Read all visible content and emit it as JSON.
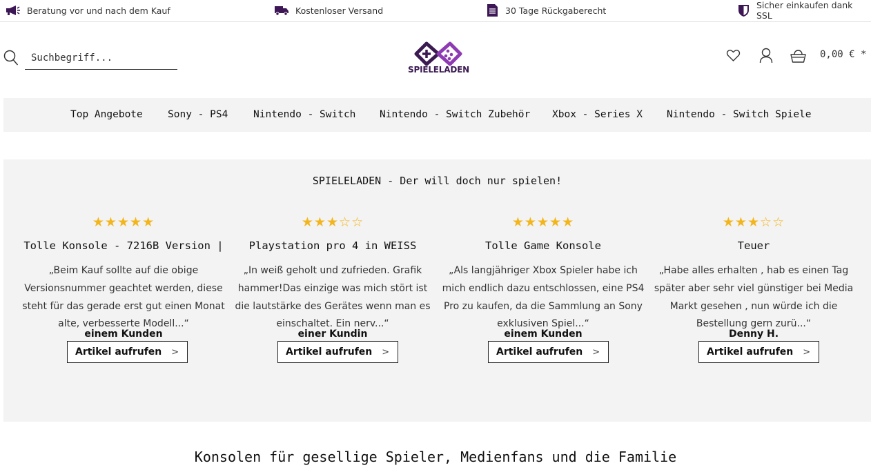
{
  "usp_bar": {
    "items": [
      {
        "icon": "megaphone-icon",
        "label": "Beratung vor und nach dem Kauf"
      },
      {
        "icon": "truck-icon",
        "label": "Kostenloser Versand"
      },
      {
        "icon": "document-icon",
        "label": "30 Tage Rückgaberecht"
      },
      {
        "icon": "shield-icon",
        "label": "Sicher einkaufen dank SSL"
      }
    ]
  },
  "header": {
    "search": {
      "placeholder": "Suchbegriff..."
    },
    "logo": {
      "text": "SPIELELADEN"
    },
    "cart_total": "0,00 € *"
  },
  "nav": {
    "items": [
      {
        "label": "Top Angebote"
      },
      {
        "label": "Sony - PS4"
      },
      {
        "label": "Nintendo - Switch"
      },
      {
        "label": "Nintendo - Switch Zubehör"
      },
      {
        "label": "Xbox - Series X"
      },
      {
        "label": "Nintendo - Switch Spiele"
      }
    ]
  },
  "reviews": {
    "title": "SPIELELADEN - Der will doch nur spielen!",
    "cards": [
      {
        "rating": 5,
        "max_rating": 5,
        "title": "Tolle Konsole - 7216B Version |",
        "text": "„Beim Kauf sollte auf die obige Versionsnummer geachtet werden, diese steht für das gerade erst gut einen Monat alte, verbesserte Modell...“",
        "author": "einem Kunden",
        "button": "Artikel aufrufen"
      },
      {
        "rating": 3,
        "max_rating": 5,
        "title": "Playstation pro 4 in WEISS",
        "text": "„In weiß geholt und zufrieden. Grafik hammer!Das einzige was mich stört ist die lautstärke des Gerätes wenn man es einschaltet. Ein nerv...“",
        "author": "einer Kundin",
        "button": "Artikel aufrufen"
      },
      {
        "rating": 5,
        "max_rating": 5,
        "title": "Tolle Game Konsole",
        "text": "„Als langjähriger Xbox Spieler habe ich mich endlich dazu entschlossen, eine PS4 Pro zu kaufen, da die Sammlung an Sony exklusiven Spiel...“",
        "author": "einem Kunden",
        "button": "Artikel aufrufen"
      },
      {
        "rating": 3,
        "max_rating": 5,
        "title": "Teuer",
        "text": "„Habe alles erhalten , hab es einen Tag später aber sehr viel günstiger bei Media Markt gesehen , nun würde ich die Bestellung gern zurü...“",
        "author": "Denny H.",
        "button": "Artikel aufrufen"
      }
    ]
  },
  "section": {
    "title": "Konsolen für gesellige Spieler, Medienfans und die Familie"
  },
  "colors": {
    "brand": "#6a1f8a",
    "star": "#f3b51c",
    "panel": "#f3f3f4"
  }
}
